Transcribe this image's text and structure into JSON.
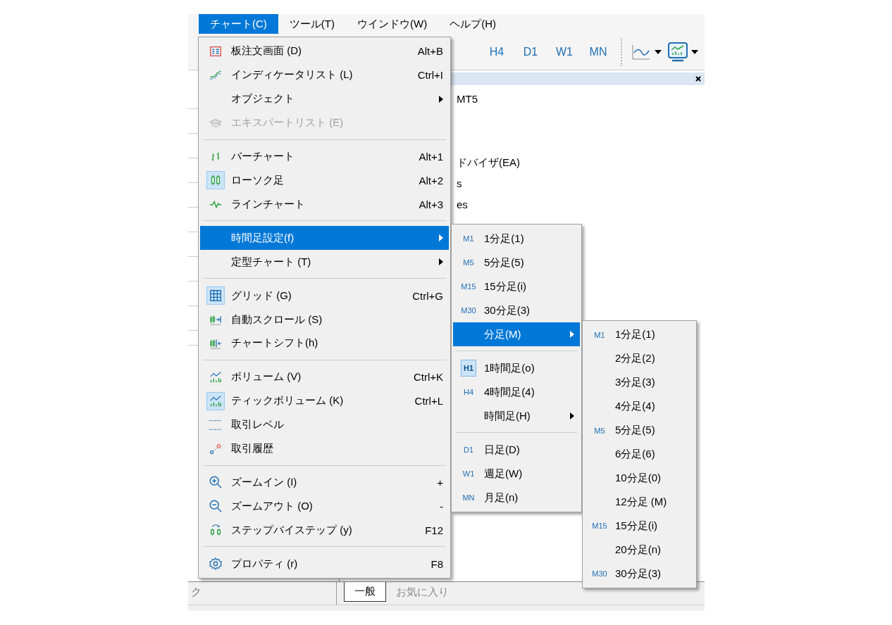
{
  "menubar": [
    {
      "label": "チャート(C)",
      "selected": true
    },
    {
      "label": "ツール(T)",
      "selected": false
    },
    {
      "label": "ウインドウ(W)",
      "selected": false
    },
    {
      "label": "ヘルプ(H)",
      "selected": false
    }
  ],
  "toolbar": {
    "timeframes": [
      {
        "label": "H4",
        "selected": false
      },
      {
        "label": "D1",
        "selected": false
      },
      {
        "label": "W1",
        "selected": false
      },
      {
        "label": "MN",
        "selected": false
      }
    ]
  },
  "navigator": {
    "items": [
      "MT5",
      "ドバイザ(EA)",
      "s",
      "es"
    ]
  },
  "bottom_tabs": {
    "left_tab": "ク",
    "tabs": [
      {
        "label": "一般",
        "selected": true
      },
      {
        "label": "お気に入り",
        "selected": false
      }
    ]
  },
  "chart_menu": {
    "items": [
      {
        "kind": "item",
        "label": "板注文画面 (D)",
        "shortcut": "Alt+B",
        "has_submenu": false,
        "checked": false,
        "disabled": false,
        "selected": false
      },
      {
        "kind": "item",
        "label": "インディケータリスト (L)",
        "shortcut": "Ctrl+I",
        "has_submenu": false,
        "checked": false,
        "disabled": false,
        "selected": false
      },
      {
        "kind": "item",
        "label": "オブジェクト",
        "has_submenu": true,
        "checked": false,
        "disabled": false,
        "selected": false
      },
      {
        "kind": "item",
        "label": "エキスパートリスト (E)",
        "has_submenu": false,
        "checked": false,
        "disabled": true,
        "selected": false
      },
      {
        "kind": "separator"
      },
      {
        "kind": "item",
        "label": "バーチャート",
        "shortcut": "Alt+1",
        "has_submenu": false,
        "checked": false,
        "disabled": false,
        "selected": false
      },
      {
        "kind": "item",
        "label": "ローソク足",
        "shortcut": "Alt+2",
        "has_submenu": false,
        "checked": true,
        "disabled": false,
        "selected": false
      },
      {
        "kind": "item",
        "label": "ラインチャート",
        "shortcut": "Alt+3",
        "has_submenu": false,
        "checked": false,
        "disabled": false,
        "selected": false
      },
      {
        "kind": "separator"
      },
      {
        "kind": "item",
        "label": "時間足設定(f)",
        "has_submenu": true,
        "checked": false,
        "disabled": false,
        "selected": true
      },
      {
        "kind": "item",
        "label": "定型チャート (T)",
        "has_submenu": true,
        "checked": false,
        "disabled": false,
        "selected": false
      },
      {
        "kind": "separator"
      },
      {
        "kind": "item",
        "label": "グリッド (G)",
        "shortcut": "Ctrl+G",
        "has_submenu": false,
        "checked": true,
        "disabled": false,
        "selected": false
      },
      {
        "kind": "item",
        "label": "自動スクロール (S)",
        "has_submenu": false,
        "checked": false,
        "disabled": false,
        "selected": false
      },
      {
        "kind": "item",
        "label": "チャートシフト(h)",
        "has_submenu": false,
        "checked": false,
        "disabled": false,
        "selected": false
      },
      {
        "kind": "separator"
      },
      {
        "kind": "item",
        "label": "ボリューム (V)",
        "shortcut": "Ctrl+K",
        "has_submenu": false,
        "checked": false,
        "disabled": false,
        "selected": false
      },
      {
        "kind": "item",
        "label": "ティックボリューム (K)",
        "shortcut": "Ctrl+L",
        "has_submenu": false,
        "checked": true,
        "disabled": false,
        "selected": false
      },
      {
        "kind": "item",
        "label": "取引レベル",
        "has_submenu": false,
        "checked": false,
        "disabled": false,
        "selected": false
      },
      {
        "kind": "item",
        "label": "取引履歴",
        "has_submenu": false,
        "checked": false,
        "disabled": false,
        "selected": false
      },
      {
        "kind": "separator"
      },
      {
        "kind": "item",
        "label": "ズームイン (I)",
        "shortcut": "+",
        "has_submenu": false,
        "checked": false,
        "disabled": false,
        "selected": false
      },
      {
        "kind": "item",
        "label": "ズームアウト (O)",
        "shortcut": "-",
        "has_submenu": false,
        "checked": false,
        "disabled": false,
        "selected": false
      },
      {
        "kind": "item",
        "label": "ステップバイステップ (y)",
        "shortcut": "F12",
        "has_submenu": false,
        "checked": false,
        "disabled": false,
        "selected": false
      },
      {
        "kind": "separator"
      },
      {
        "kind": "item",
        "label": "プロパティ (r)",
        "shortcut": "F8",
        "has_submenu": false,
        "checked": false,
        "disabled": false,
        "selected": false
      }
    ]
  },
  "timeframe_menu": {
    "items": [
      {
        "kind": "item",
        "tag": "M1",
        "label": "1分足(1)",
        "has_submenu": false,
        "checked": false,
        "selected": false
      },
      {
        "kind": "item",
        "tag": "M5",
        "label": "5分足(5)",
        "has_submenu": false,
        "checked": false,
        "selected": false
      },
      {
        "kind": "item",
        "tag": "M15",
        "label": "15分足(i)",
        "has_submenu": false,
        "checked": false,
        "selected": false
      },
      {
        "kind": "item",
        "tag": "M30",
        "label": "30分足(3)",
        "has_submenu": false,
        "checked": false,
        "selected": false
      },
      {
        "kind": "item",
        "label": "分足(M)",
        "has_submenu": true,
        "checked": false,
        "selected": true
      },
      {
        "kind": "separator"
      },
      {
        "kind": "item",
        "tag": "H1",
        "label": "1時間足(o)",
        "has_submenu": false,
        "checked": true,
        "selected": false
      },
      {
        "kind": "item",
        "tag": "H4",
        "label": "4時間足(4)",
        "has_submenu": false,
        "checked": false,
        "selected": false
      },
      {
        "kind": "item",
        "label": "時間足(H)",
        "has_submenu": true,
        "checked": false,
        "selected": false
      },
      {
        "kind": "separator"
      },
      {
        "kind": "item",
        "tag": "D1",
        "label": "日足(D)",
        "has_submenu": false,
        "checked": false,
        "selected": false
      },
      {
        "kind": "item",
        "tag": "W1",
        "label": "週足(W)",
        "has_submenu": false,
        "checked": false,
        "selected": false
      },
      {
        "kind": "item",
        "tag": "MN",
        "label": "月足(n)",
        "has_submenu": false,
        "checked": false,
        "selected": false
      }
    ]
  },
  "minute_menu": {
    "items": [
      {
        "kind": "item",
        "tag": "M1",
        "label": "1分足(1)",
        "selected": false
      },
      {
        "kind": "item",
        "label": "2分足(2)",
        "selected": false
      },
      {
        "kind": "item",
        "label": "3分足(3)",
        "selected": false
      },
      {
        "kind": "item",
        "label": "4分足(4)",
        "selected": false
      },
      {
        "kind": "item",
        "tag": "M5",
        "label": "5分足(5)",
        "selected": false
      },
      {
        "kind": "item",
        "label": "6分足(6)",
        "selected": false
      },
      {
        "kind": "item",
        "label": "10分足(0)",
        "selected": false
      },
      {
        "kind": "item",
        "label": "12分足 (M)",
        "selected": false
      },
      {
        "kind": "item",
        "tag": "M15",
        "label": "15分足(i)",
        "selected": false
      },
      {
        "kind": "item",
        "label": "20分足(n)",
        "selected": false
      },
      {
        "kind": "item",
        "tag": "M30",
        "label": "30分足(3)",
        "selected": false
      }
    ]
  }
}
